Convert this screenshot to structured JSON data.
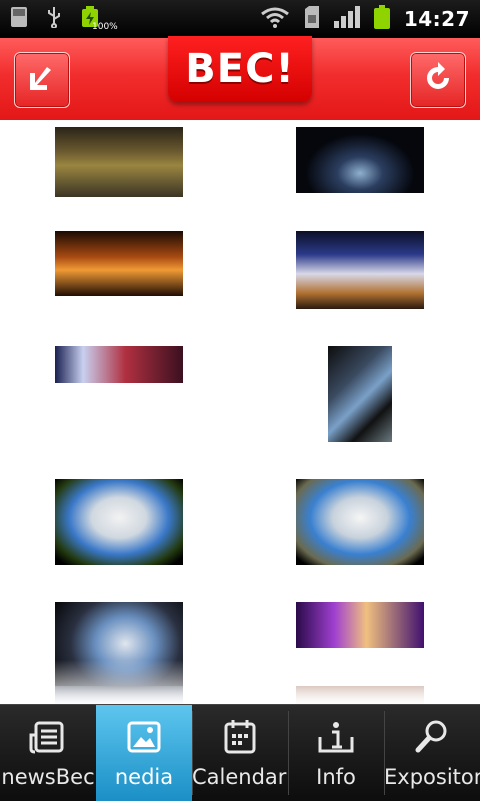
{
  "status_bar": {
    "battery_label": "100%",
    "time": "14:27"
  },
  "header": {
    "logo_text": "BEC!",
    "back_icon": "back-arrow-icon",
    "refresh_icon": "refresh-icon"
  },
  "gallery": {
    "items": [
      {
        "name": "arena-dirt-track-photo"
      },
      {
        "name": "arena-stage-lights-photo"
      },
      {
        "name": "concert-stage-photo"
      },
      {
        "name": "exhibition-hall-interior-photo"
      },
      {
        "name": "crowd-panorama-photo"
      },
      {
        "name": "steel-structure-photo"
      },
      {
        "name": "building-exterior-fisheye-photo"
      },
      {
        "name": "building-exterior-fisheye-photo-2"
      },
      {
        "name": "structure-underside-fisheye-photo"
      },
      {
        "name": "auditorium-purple-lights-photo"
      }
    ]
  },
  "tabs": [
    {
      "label": "newsBec",
      "icon": "news-icon"
    },
    {
      "label": "nedia",
      "icon": "image-icon",
      "selected": true
    },
    {
      "label": "Calendaric",
      "icon": "calendar-icon"
    },
    {
      "label": "Info",
      "icon": "info-icon"
    },
    {
      "label": "Expositore",
      "icon": "search-icon"
    }
  ],
  "colors": {
    "header_red": "#e31717",
    "tab_selected": "#1b8fc6",
    "tab_bar": "#1a1a1a"
  }
}
